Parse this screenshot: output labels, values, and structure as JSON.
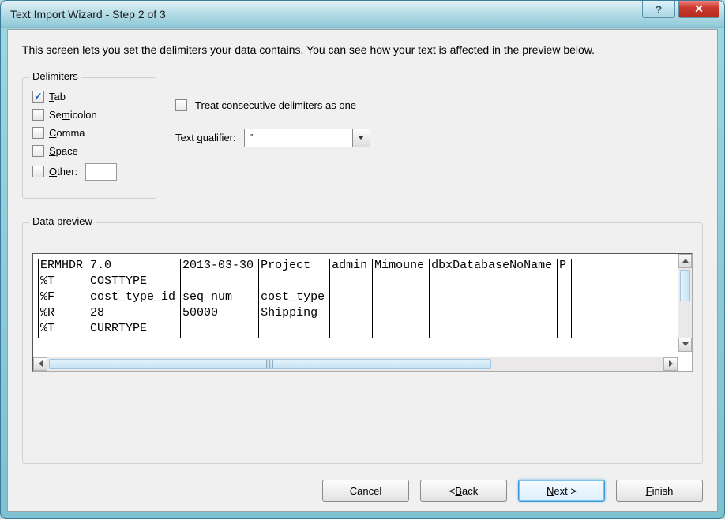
{
  "title": "Text Import Wizard - Step 2 of 3",
  "intro": "This screen lets you set the delimiters your data contains. You can see how your text is affected in the preview below.",
  "delimiters": {
    "legend": "Delimiters",
    "tab_label": "Tab",
    "tab_checked": true,
    "semicolon_label": "Semicolon",
    "comma_label": "Comma",
    "space_label": "Space",
    "other_label": "Other:"
  },
  "treat_label": "Treat consecutive delimiters as one",
  "qualifier_label": "Text qualifier:",
  "qualifier_value": "\"",
  "preview_legend": "Data preview",
  "preview_rows": [
    [
      "ERMHDR",
      "7.0",
      "2013-03-30",
      "Project",
      "admin",
      "Mimoune",
      "dbxDatabaseNoName",
      "P"
    ],
    [
      "%T",
      "COSTTYPE",
      "",
      "",
      "",
      "",
      "",
      ""
    ],
    [
      "%F",
      "cost_type_id",
      "seq_num",
      "cost_type",
      "",
      "",
      "",
      ""
    ],
    [
      "%R",
      "28",
      "50000",
      "Shipping",
      "",
      "",
      "",
      ""
    ],
    [
      "%T",
      "CURRTYPE",
      "",
      "",
      "",
      "",
      "",
      ""
    ]
  ],
  "buttons": {
    "cancel": "Cancel",
    "back": "< Back",
    "next": "Next >",
    "finish": "Finish"
  }
}
